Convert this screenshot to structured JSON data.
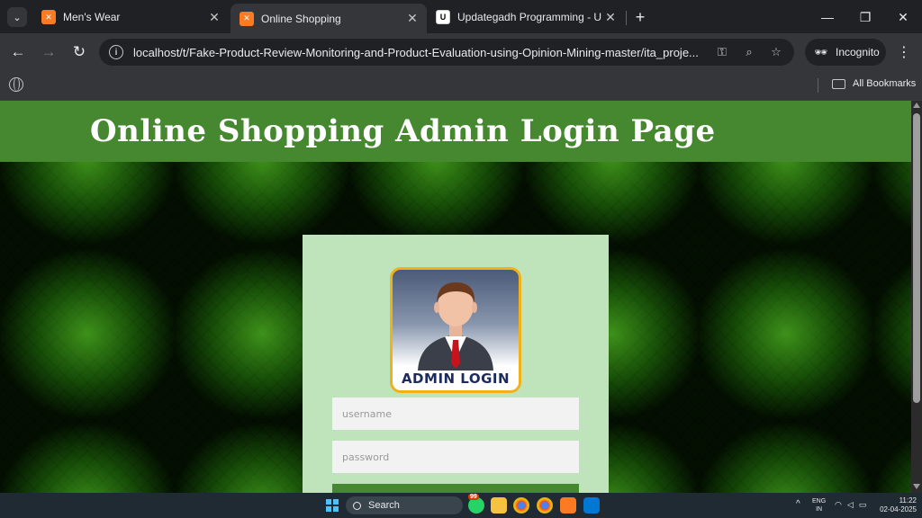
{
  "browser": {
    "tabs": [
      {
        "title": "Men's Wear",
        "favicon": "xampp-icon"
      },
      {
        "title": "Online Shopping",
        "favicon": "xampp-icon"
      },
      {
        "title": "Updategadh Programming - Upda",
        "favicon": "updategadh-icon"
      }
    ],
    "url": "localhost/t/Fake-Product-Review-Monitoring-and-Product-Evaluation-using-Opinion-Mining-master/ita_proje...",
    "incognito_label": "Incognito",
    "bookmarks_label": "All Bookmarks",
    "colors": {
      "frame": "#202124",
      "toolbar": "#35363a"
    }
  },
  "page": {
    "title": "Online Shopping Admin Login Page",
    "admin_image_label": "ADMIN LOGIN",
    "username_placeholder": "username",
    "password_placeholder": "password",
    "colors": {
      "header": "#468830",
      "card": "#bfe3bb",
      "button": "#468830"
    }
  },
  "taskbar": {
    "search_label": "Search",
    "badge": "99",
    "lang_line1": "ENG",
    "lang_line2": "IN",
    "time": "11:22",
    "date": "02-04-2025"
  }
}
